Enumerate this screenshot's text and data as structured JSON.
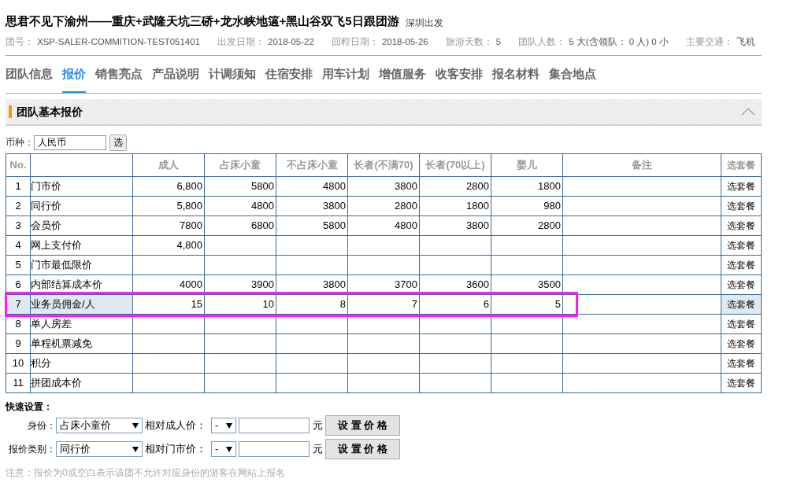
{
  "title": "思君不见下渝州——重庆+武隆天坑三硚+龙水峡地簻+黑山谷双飞5日跟团游",
  "departure_city": "深圳出发",
  "info": [
    {
      "label": "团号：",
      "value": "XSP-SALER-COMMITION-TEST051401"
    },
    {
      "label": "出发日期：",
      "value": "2018-05-22"
    },
    {
      "label": "回程日期：",
      "value": "2018-05-26"
    },
    {
      "label": "旅游天数：",
      "value": "5"
    },
    {
      "label": "团队人数：",
      "value": "5 大(含领队： 0 人) 0 小"
    },
    {
      "label": "主要交通：",
      "value": "飞机"
    }
  ],
  "tabs": [
    {
      "label": "团队信息",
      "selected": false
    },
    {
      "label": "报价",
      "selected": true
    },
    {
      "label": "销售亮点",
      "selected": false
    },
    {
      "label": "产品说明",
      "selected": false
    },
    {
      "label": "计调须知",
      "selected": false
    },
    {
      "label": "住宿安排",
      "selected": false
    },
    {
      "label": "用车计划",
      "selected": false
    },
    {
      "label": "增值服务",
      "selected": false
    },
    {
      "label": "收客安排",
      "selected": false
    },
    {
      "label": "报名材料",
      "selected": false
    },
    {
      "label": "集合地点",
      "selected": false
    }
  ],
  "section": {
    "title": "团队基本报价",
    "expanded": true
  },
  "currency": {
    "label": "币种：",
    "value": "人民币",
    "button": "选"
  },
  "table": {
    "header": {
      "no": "No.",
      "prices": [
        "成人",
        "占床小童",
        "不占床小童",
        "长者(不满70)",
        "长者(70以上)",
        "婴儿"
      ],
      "remark": "备注",
      "action": "选套餐"
    },
    "rows": [
      {
        "no": "1",
        "name": "门市价",
        "prices": [
          "6,800",
          "5800",
          "4800",
          "3800",
          "2800",
          "1800"
        ],
        "action": "选套餐",
        "selected": false
      },
      {
        "no": "2",
        "name": "同行价",
        "prices": [
          "5,800",
          "4800",
          "3800",
          "2800",
          "1800",
          "980"
        ],
        "action": "选套餐",
        "selected": false
      },
      {
        "no": "3",
        "name": "会员价",
        "prices": [
          "7800",
          "6800",
          "5800",
          "4800",
          "3800",
          "2800"
        ],
        "action": "选套餐",
        "selected": false
      },
      {
        "no": "4",
        "name": "网上支付价",
        "prices": [
          "4,800"
        ],
        "action": "选套餐",
        "selected": false
      },
      {
        "no": "5",
        "name": "门市最低限价",
        "action": "选套餐",
        "selected": false
      },
      {
        "no": "6",
        "name": "内部结算成本价",
        "prices": [
          "4000",
          "3900",
          "3800",
          "3700",
          "3600",
          "3500"
        ],
        "action": "选套餐",
        "selected": false
      },
      {
        "no": "7",
        "name": "业务员佣金/人",
        "prices": [
          "15",
          "10",
          "8",
          "7",
          "6",
          "5"
        ],
        "action": "选套餐",
        "selected": true
      },
      {
        "no": "8",
        "name": "单人房差",
        "action": "选套餐",
        "selected": false
      },
      {
        "no": "9",
        "name": "单程机票减免",
        "action": "选套餐",
        "selected": false
      },
      {
        "no": "10",
        "name": "积分",
        "action": "选套餐",
        "selected": false
      },
      {
        "no": "11",
        "name": "拼团成本价",
        "action": "选套餐",
        "selected": false
      }
    ]
  },
  "quick_settings": {
    "title": "快速设置：",
    "rows": [
      {
        "label": "身份：",
        "select": "占床小童价",
        "relative_label": "相对成人价：",
        "operator": "-",
        "unit": "元",
        "button": "设 置 价 格"
      },
      {
        "label": "报价类别：",
        "select": "同行价",
        "relative_label": "相对门市价：",
        "operator": "-",
        "unit": "元",
        "button": "设 置 价 格"
      }
    ]
  },
  "note": "注意：报价为0或空白表示该团不允许对应身份的游客在网站上报名"
}
